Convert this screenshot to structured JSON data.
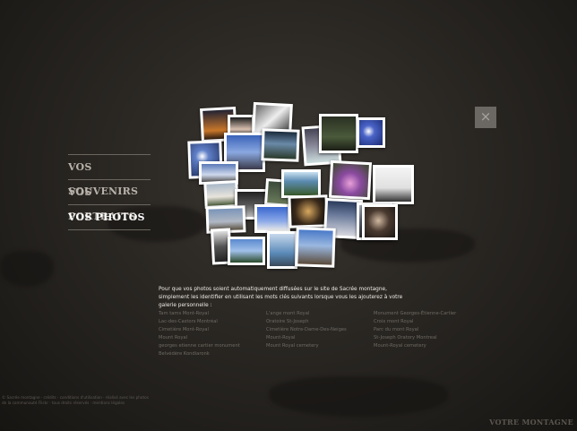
{
  "menu": {
    "items": [
      {
        "label": "VOS SOUVENIRS"
      },
      {
        "label": "VOS PORTRAITS"
      },
      {
        "label": "VOS PHOTOS"
      }
    ]
  },
  "close": {
    "label": "×"
  },
  "description": "Pour que vos photos soient automatiquement diffusées sur le site de Sacrée montagne, simplement les identifier en utilisant les mots clés suivants lorsque vous les ajouterez à votre galerie personnelle :",
  "tags": {
    "col1": [
      "Tam tams Mont-Royal",
      "Lac-des-Castors Montréal",
      "Cimetière Mont-Royal",
      "Mount Royal",
      "georges etienne cartier monument",
      "Belvédère Kondiaronk"
    ],
    "col2": [
      "L'ange mont Royal",
      "Oratoire St-Joseph",
      "Cimetière Notre-Dame-Des-Neiges",
      "Mount-Royal",
      "Mount Royal cemetery"
    ],
    "col3": [
      "Monument Georges-Étienne-Cartier",
      "Croix mont Royal",
      "Parc du mont Royal",
      "St-Joseph Oratory Montreal",
      "Mount-Royal cemetery"
    ]
  },
  "credits": "© Sacrée montagne · crédits · conditions d'utilisation · réalisé avec les photos de la communauté Flickr · tous droits réservés · mentions légales",
  "brand": "VOTRE MONTAGNE",
  "colors": {
    "accent": "#ffffff",
    "menu_inactive": "#b8b2aa",
    "background": "#2a2723"
  }
}
